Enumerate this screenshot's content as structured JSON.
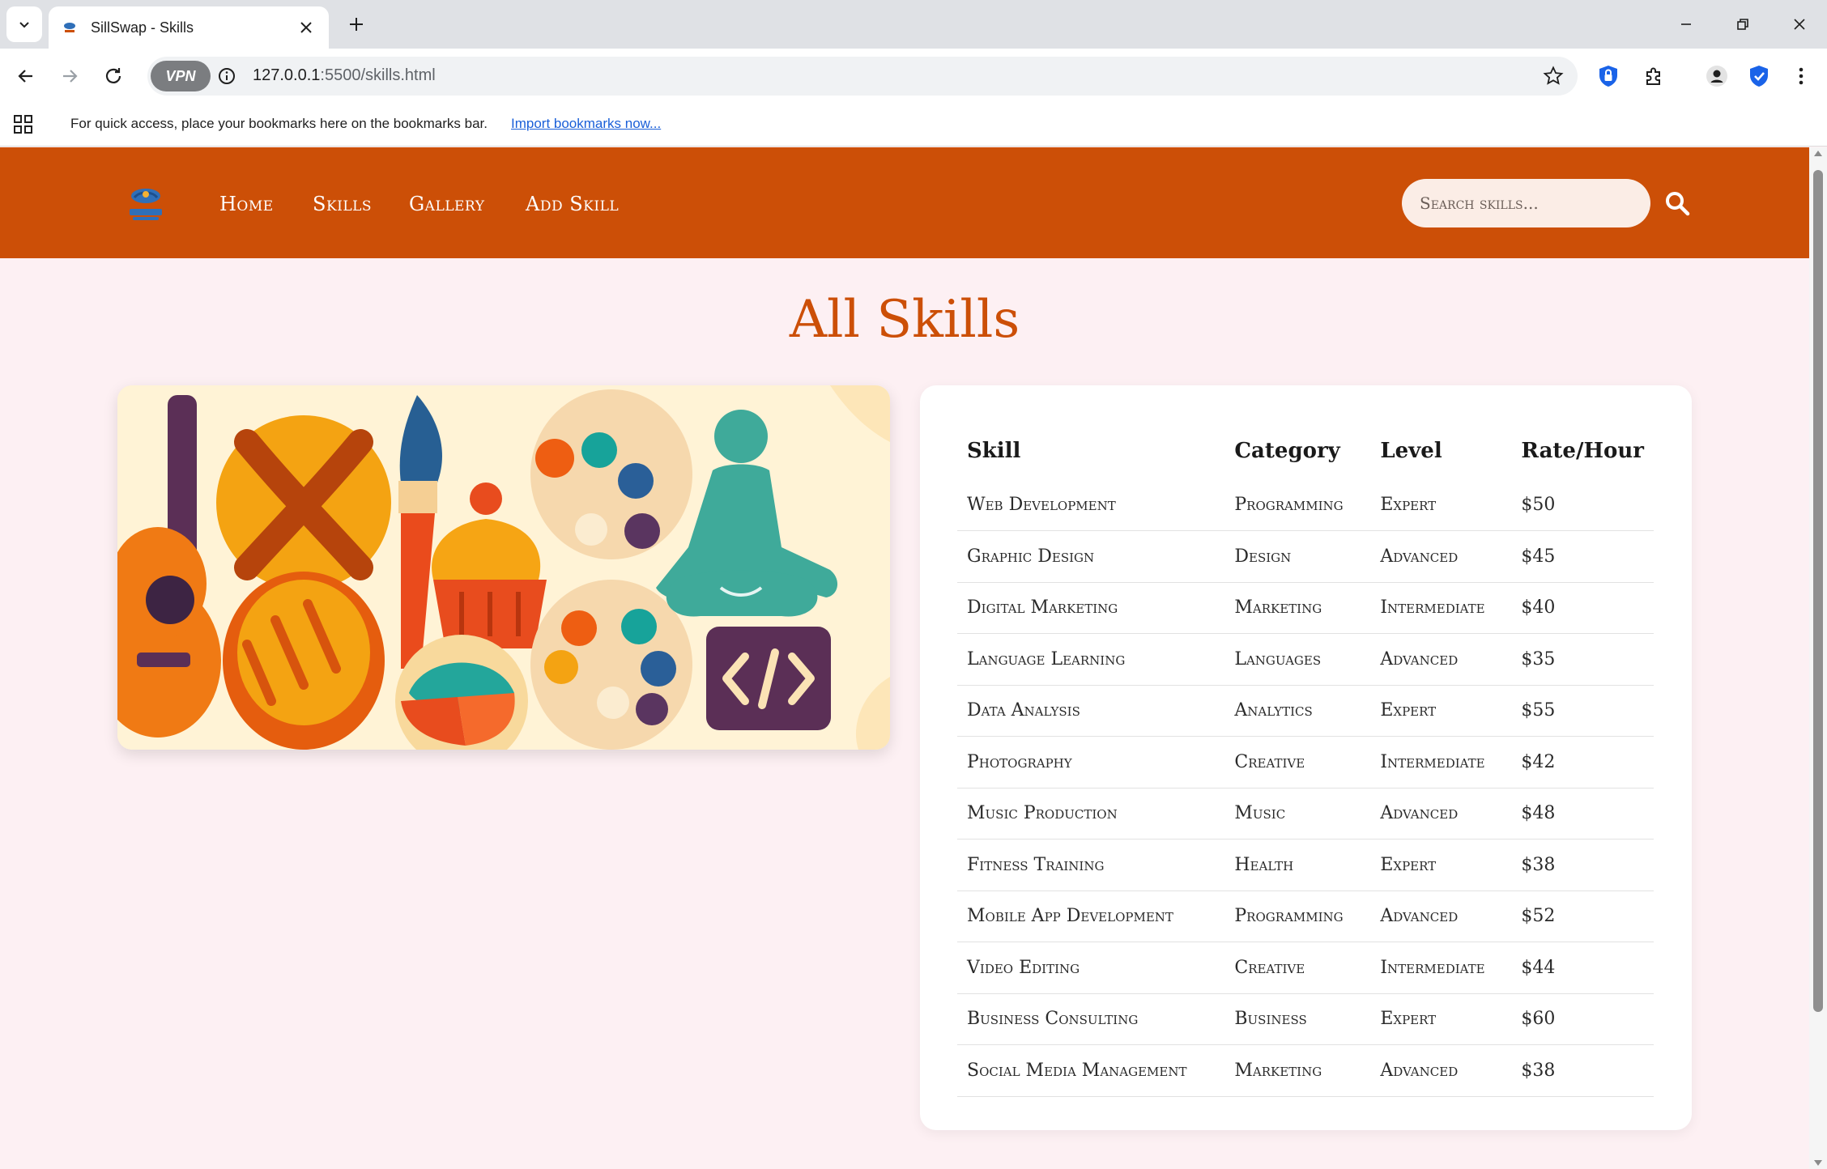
{
  "browser": {
    "tab_title": "SillSwap - Skills",
    "url_host": "127.0.0.1",
    "url_path": ":5500/skills.html",
    "vpn_label": "VPN",
    "bookmarks_prompt": "For quick access, place your bookmarks here on the bookmarks bar.",
    "bookmarks_import": "Import bookmarks now..."
  },
  "site": {
    "nav": [
      "Home",
      "Skills",
      "Gallery",
      "Add Skill"
    ],
    "search_placeholder": "Search skills...",
    "page_title": "All Skills"
  },
  "table": {
    "headers": [
      "Skill",
      "Category",
      "Level",
      "Rate/Hour"
    ],
    "rows": [
      [
        "Web Development",
        "Programming",
        "Expert",
        "$50"
      ],
      [
        "Graphic Design",
        "Design",
        "Advanced",
        "$45"
      ],
      [
        "Digital Marketing",
        "Marketing",
        "Intermediate",
        "$40"
      ],
      [
        "Language Learning",
        "Languages",
        "Advanced",
        "$35"
      ],
      [
        "Data Analysis",
        "Analytics",
        "Expert",
        "$55"
      ],
      [
        "Photography",
        "Creative",
        "Intermediate",
        "$42"
      ],
      [
        "Music Production",
        "Music",
        "Advanced",
        "$48"
      ],
      [
        "Fitness Training",
        "Health",
        "Expert",
        "$38"
      ],
      [
        "Mobile App Development",
        "Programming",
        "Advanced",
        "$52"
      ],
      [
        "Video Editing",
        "Creative",
        "Intermediate",
        "$44"
      ],
      [
        "Business Consulting",
        "Business",
        "Expert",
        "$60"
      ],
      [
        "Social Media Management",
        "Marketing",
        "Advanced",
        "$38"
      ]
    ]
  },
  "colors": {
    "brand": "#cc4f07",
    "page_bg": "#fdf0f3",
    "search_bg": "#fbede6"
  }
}
